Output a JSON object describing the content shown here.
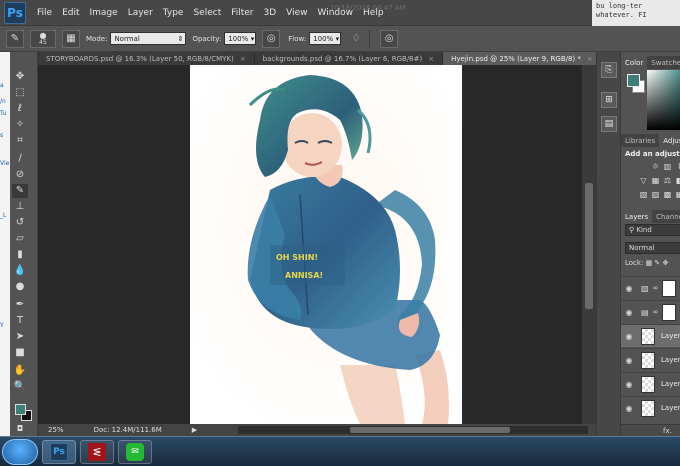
{
  "app": {
    "logo": "Ps"
  },
  "menu": [
    "File",
    "Edit",
    "Image",
    "Layer",
    "Type",
    "Select",
    "Filter",
    "3D",
    "View",
    "Window",
    "Help"
  ],
  "background_window": {
    "text": "10/18/2016 04:47 AM",
    "right_text": [
      "bu long-ter",
      "whatever. FI"
    ]
  },
  "options": {
    "brush_size": "45",
    "mode_label": "Mode:",
    "mode_value": "Normal",
    "opacity_label": "Opacity:",
    "opacity_value": "100%",
    "flow_label": "Flow:",
    "flow_value": "100%"
  },
  "tabs": [
    {
      "label": "STORYBOARDS.psd @ 16.3% (Layer 50, RGB/8/CMYK)",
      "active": false
    },
    {
      "label": "backgrounds.psd @ 16.7% (Layer 6, RGB/8#)",
      "active": false
    },
    {
      "label": "Hyejin.psd @ 25% (Layer 9, RGB/8) *",
      "active": true
    }
  ],
  "status": {
    "zoom": "25%",
    "doc": "Doc: 12.4M/111.6M"
  },
  "artwork": {
    "text_line1": "OH SHIN!",
    "text_line2": "ANNISA!"
  },
  "panels": {
    "color_tabs": [
      "Color",
      "Swatches"
    ],
    "lib_tabs": [
      "Libraries",
      "Adjustments"
    ],
    "adj_title": "Add an adjustment",
    "layer_tabs": [
      "Layers",
      "Channels"
    ],
    "kind": "Kind",
    "blend": "Normal",
    "lock": "Lock:",
    "layers": [
      {
        "name": "",
        "type": "adjustment",
        "selected": false
      },
      {
        "name": "",
        "type": "adjustment2",
        "selected": false
      },
      {
        "name": "Layer",
        "type": "pixel",
        "selected": true
      },
      {
        "name": "Layer",
        "type": "pixel",
        "selected": false
      },
      {
        "name": "Layer",
        "type": "pixel",
        "selected": false
      },
      {
        "name": "Layer",
        "type": "pixel",
        "selected": false
      }
    ],
    "footer": "fx."
  },
  "left_strip": [
    "a",
    "/n",
    "Tu",
    "s",
    "Vie",
    "_L",
    "Y"
  ],
  "colors": {
    "foreground": "#3d7f78",
    "background": "#ffffff",
    "accent": "#3fa3f0"
  }
}
